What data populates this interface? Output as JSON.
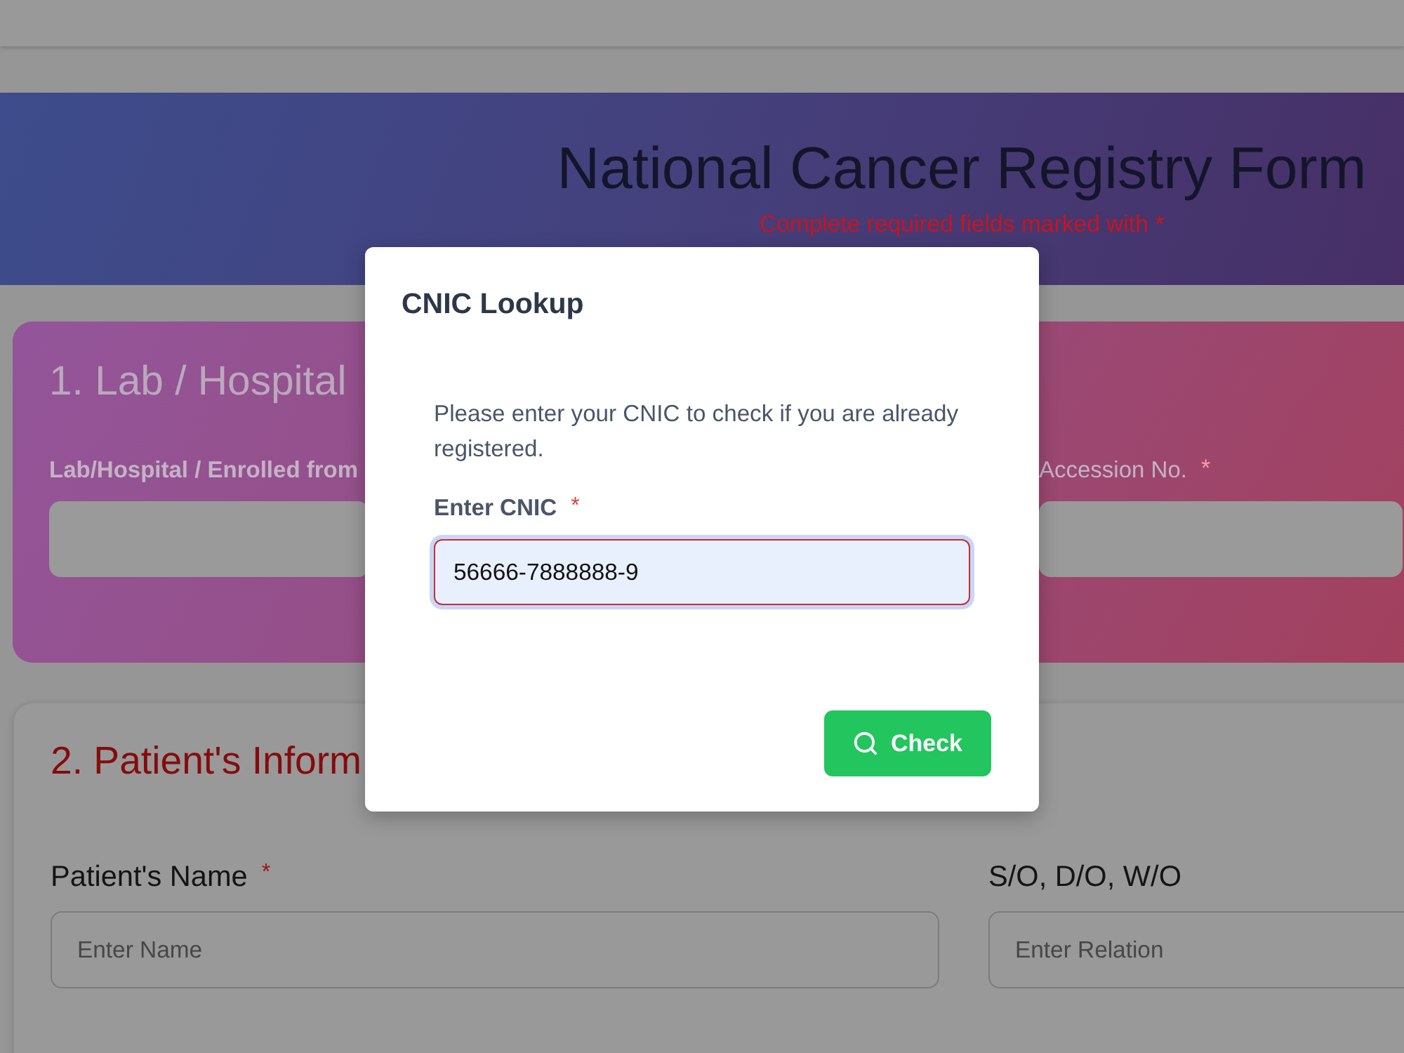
{
  "header": {
    "title": "National Cancer Registry Form",
    "subtitle": "Complete required fields marked with *"
  },
  "sections": [
    {
      "kind": "gradient",
      "title": "1. Lab / Hospital",
      "fields": [
        {
          "label": "Lab/Hospital / Enrolled from",
          "bold": true
        },
        {
          "label": "Accession No.",
          "required_mark": "*",
          "bold": false
        }
      ]
    },
    {
      "kind": "plain",
      "title": "2. Patient's Inform",
      "fields": [
        {
          "label": "Patient's Name",
          "required_mark": "*",
          "bold": false,
          "placeholder": "Enter Name"
        },
        {
          "label": "S/O, D/O, W/O",
          "bold": false,
          "placeholder": "Enter Relation"
        }
      ]
    }
  ],
  "dialog": {
    "title": "CNIC Lookup",
    "message": "Please enter your CNIC to check if you are already registered.",
    "field": {
      "label": "Enter CNIC",
      "required_mark": "*",
      "value": "56666-7888888-9",
      "focused": true,
      "invalid": true,
      "autofilled": true
    },
    "button": {
      "label": "Check"
    }
  }
}
